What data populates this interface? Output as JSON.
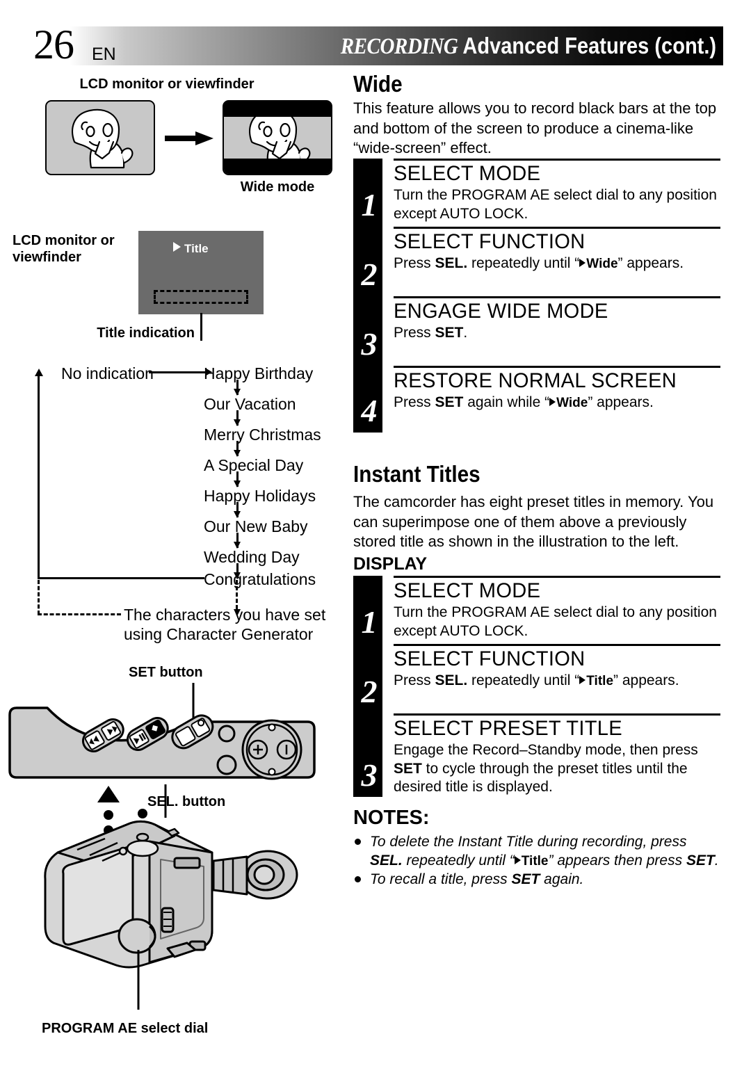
{
  "header": {
    "page_number": "26",
    "language": "EN",
    "title_italic": "RECORDING",
    "title_rest": "Advanced Features (cont.)"
  },
  "left": {
    "fig_wide": {
      "caption_top": "LCD monitor or viewfinder",
      "caption_bottom": "Wide mode",
      "arrow_icon": "right-arrow-icon"
    },
    "fig_title_lcd": {
      "caption": "LCD monitor or viewfinder",
      "osd_text": "Title",
      "indication_caption": "Title indication"
    },
    "flow": {
      "start": "No indication",
      "items": [
        "Happy Birthday",
        "Our Vacation",
        "Merry Christmas",
        "A Special Day",
        "Happy Holidays",
        "Our New Baby",
        "Wedding Day",
        "Congratulations"
      ],
      "character_generator_line1": "The characters you have set",
      "character_generator_line2": "using Character Generator"
    },
    "fig_panel": {
      "set_button_label": "SET button",
      "sel_button_label": "SEL. button"
    },
    "fig_camcorder": {
      "program_ae_label": "PROGRAM AE select dial"
    }
  },
  "right": {
    "wide": {
      "heading": "Wide",
      "body": "This feature allows you to record black bars at the top and bottom of the screen to produce a cinema-like “wide-screen” effect.",
      "steps": [
        {
          "number": "1",
          "title": "SELECT MODE",
          "desc_pre": "Turn the PROGRAM AE select dial to any position except AUTO LOCK.",
          "desc_bold": "",
          "desc_mid": "",
          "osd": "",
          "desc_post": ""
        },
        {
          "number": "2",
          "title": "SELECT FUNCTION",
          "desc_pre": "Press ",
          "desc_bold": "SEL.",
          "desc_mid": " repeatedly until “",
          "osd": "Wide",
          "desc_post": "” appears."
        },
        {
          "number": "3",
          "title": "ENGAGE WIDE MODE",
          "desc_pre": "Press ",
          "desc_bold": "SET",
          "desc_mid": ".",
          "osd": "",
          "desc_post": ""
        },
        {
          "number": "4",
          "title": "RESTORE NORMAL SCREEN",
          "desc_pre": "Press ",
          "desc_bold": "SET",
          "desc_mid": " again while “",
          "osd": "Wide",
          "desc_post": "” appears."
        }
      ]
    },
    "instant_titles": {
      "heading": "Instant Titles",
      "body": "The camcorder has eight preset titles in memory. You can superimpose one of them above a previously stored title as shown in the illustration to the left.",
      "display_label": "DISPLAY",
      "steps": [
        {
          "number": "1",
          "title": "SELECT MODE",
          "desc_pre": "Turn the PROGRAM AE select dial to any position except AUTO LOCK.",
          "desc_bold": "",
          "desc_mid": "",
          "osd": "",
          "desc_post": ""
        },
        {
          "number": "2",
          "title": "SELECT FUNCTION",
          "desc_pre": "Press ",
          "desc_bold": "SEL.",
          "desc_mid": " repeatedly until “",
          "osd": "Title",
          "desc_post": "” appears."
        },
        {
          "number": "3",
          "title": "SELECT PRESET TITLE",
          "desc_pre": "Engage the Record–Standby mode, then press ",
          "desc_bold": "SET",
          "desc_mid": " to cycle through the preset titles until the desired title is displayed.",
          "osd": "",
          "desc_post": ""
        }
      ]
    },
    "notes": {
      "heading": "NOTES:",
      "items": [
        {
          "pre": "To delete the Instant Title during recording, press ",
          "bold1": "SEL.",
          "mid": " repeatedly until “",
          "osd": "Title",
          "post": "” appears then press ",
          "bold2": "SET",
          "end": "."
        },
        {
          "pre": "To recall a title, press ",
          "bold1": "SET",
          "mid": " again.",
          "osd": "",
          "post": "",
          "bold2": "",
          "end": ""
        }
      ]
    }
  }
}
